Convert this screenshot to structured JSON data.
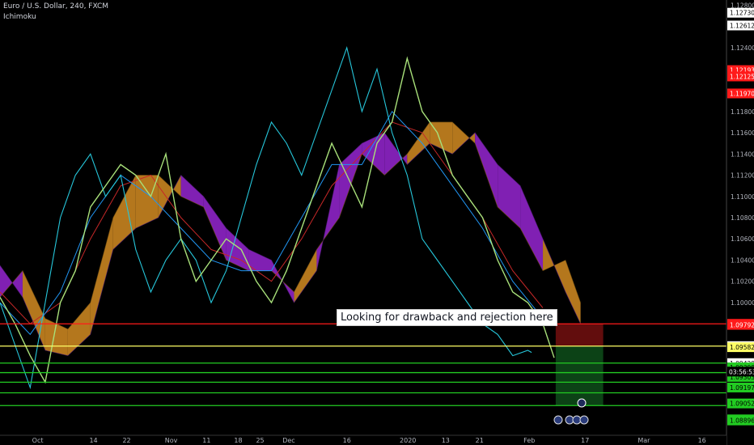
{
  "header": {
    "title": "Euro / U.S. Dollar, 240, FXCM",
    "indicator": "Ichimoku"
  },
  "annotation": "Looking for drawback and rejection here",
  "countdown": "03:56:53",
  "colors": {
    "background": "#000000",
    "price": "#a8e07a",
    "tenkan": "#2196f3",
    "kijun": "#c62828",
    "chikou": "#26c6da",
    "cloud_bull": "#c88420",
    "cloud_bear": "#8e24c7",
    "resistance": "#ff1a1a",
    "pivot": "#ffff66",
    "support": "#22cc22"
  },
  "chart_data": {
    "type": "line",
    "ylim": [
      1.0875,
      1.1285
    ],
    "xlim": [
      0,
      100
    ],
    "x_ticks": [
      {
        "label": "Oct",
        "pos": 5
      },
      {
        "label": "14",
        "pos": 12.4
      },
      {
        "label": "22",
        "pos": 16.8
      },
      {
        "label": "Nov",
        "pos": 22.7
      },
      {
        "label": "11",
        "pos": 27.4
      },
      {
        "label": "18",
        "pos": 31.6
      },
      {
        "label": "25",
        "pos": 34.5
      },
      {
        "label": "Dec",
        "pos": 38.3
      },
      {
        "label": "16",
        "pos": 46
      },
      {
        "label": "2020",
        "pos": 54.1
      },
      {
        "label": "13",
        "pos": 59.1
      },
      {
        "label": "21",
        "pos": 63.6
      },
      {
        "label": "Feb",
        "pos": 70.2
      },
      {
        "label": "17",
        "pos": 77.6
      },
      {
        "label": "Mar",
        "pos": 85.4
      },
      {
        "label": "16",
        "pos": 93.1
      }
    ],
    "y_ticks": [
      1.128,
      1.1273,
      1.1261,
      1.124,
      1.1219,
      1.1213,
      1.1197,
      1.118,
      1.116,
      1.114,
      1.112,
      1.11,
      1.108,
      1.106,
      1.104,
      1.102,
      1.1,
      1.098,
      1.0979,
      1.0959,
      1.0958,
      1.0943,
      1.0939,
      1.093,
      1.092,
      1.0905,
      1.089,
      1.0889
    ],
    "price_labels": [
      {
        "value": 1.1273,
        "label": "1.12730",
        "bg": "#ffffff",
        "fg": "#000000"
      },
      {
        "value": 1.1261,
        "label": "1.12612",
        "bg": "#ffffff",
        "fg": "#000000"
      },
      {
        "value": 1.1219,
        "label": "1.12193",
        "bg": "#ff1a1a",
        "fg": "#ffffff"
      },
      {
        "value": 1.1213,
        "label": "1.12125",
        "bg": "#ff1a1a",
        "fg": "#ffffff"
      },
      {
        "value": 1.1197,
        "label": "1.11970",
        "bg": "#ff1a1a",
        "fg": "#ffffff"
      },
      {
        "value": 1.098,
        "label": "1.09800",
        "bg": "#ff1a1a",
        "fg": "#ffffff"
      },
      {
        "value": 1.0979,
        "label": "1.09792",
        "bg": "#ff1a1a",
        "fg": "#ffffff"
      },
      {
        "value": 1.0959,
        "label": "1.09590",
        "bg": "#ffffff",
        "fg": "#000000"
      },
      {
        "value": 1.0958,
        "label": "1.09582",
        "bg": "#ffff66",
        "fg": "#000000"
      },
      {
        "value": 1.0943,
        "label": "1.09429",
        "bg": "#ffffff",
        "fg": "#000000"
      },
      {
        "value": 1.0939,
        "label": "1.09398",
        "bg": "#22cc22",
        "fg": "#000000"
      },
      {
        "value": 1.093,
        "label": "1.09303",
        "bg": "#22cc22",
        "fg": "#000000"
      },
      {
        "value": 1.092,
        "label": "1.09197",
        "bg": "#22cc22",
        "fg": "#000000"
      },
      {
        "value": 1.0905,
        "label": "1.09052",
        "bg": "#22cc22",
        "fg": "#000000"
      },
      {
        "value": 1.089,
        "label": "1.08902",
        "bg": "#22cc22",
        "fg": "#000000"
      },
      {
        "value": 1.0889,
        "label": "1.08896",
        "bg": "#22cc22",
        "fg": "#000000"
      }
    ],
    "horizontal_lines": [
      {
        "value": 1.098,
        "color": "#ff1a1a"
      },
      {
        "value": 1.0959,
        "color": "#ffff66"
      },
      {
        "value": 1.0943,
        "color": "#22cc22"
      },
      {
        "value": 1.0934,
        "color": "#22cc22"
      },
      {
        "value": 1.0925,
        "color": "#22cc22"
      },
      {
        "value": 1.0915,
        "color": "#22cc22"
      },
      {
        "value": 1.0903,
        "color": "#22cc22"
      }
    ],
    "series": [
      {
        "key": "price",
        "x": [
          0,
          2,
          4,
          6,
          8,
          10,
          12,
          14,
          16,
          18,
          20,
          22,
          24,
          26,
          28,
          30,
          32,
          34,
          36,
          38,
          40,
          42,
          44,
          46,
          48,
          50,
          52,
          54,
          56,
          58,
          60,
          62,
          64,
          66,
          68,
          70,
          72,
          73.5
        ],
        "values": [
          1.1005,
          1.098,
          1.095,
          1.0925,
          1.1,
          1.103,
          1.109,
          1.111,
          1.113,
          1.112,
          1.11,
          1.114,
          1.106,
          1.102,
          1.104,
          1.106,
          1.105,
          1.102,
          1.1,
          1.103,
          1.107,
          1.111,
          1.115,
          1.112,
          1.109,
          1.115,
          1.117,
          1.123,
          1.118,
          1.116,
          1.112,
          1.11,
          1.108,
          1.104,
          1.101,
          1.1,
          1.098,
          1.0948
        ]
      },
      {
        "key": "chikou",
        "x": [
          0,
          2,
          4,
          6,
          8,
          10,
          12,
          14,
          16,
          18,
          20,
          22,
          24,
          26,
          28,
          30,
          32,
          34,
          36,
          38,
          40,
          42,
          44,
          46,
          48,
          50,
          52,
          54,
          56,
          58,
          60,
          62,
          64,
          66,
          68,
          70,
          70.5
        ],
        "values": [
          1.1,
          1.096,
          1.092,
          1.1,
          1.108,
          1.112,
          1.114,
          1.11,
          1.112,
          1.105,
          1.101,
          1.104,
          1.106,
          1.104,
          1.1,
          1.103,
          1.108,
          1.113,
          1.117,
          1.115,
          1.112,
          1.116,
          1.12,
          1.124,
          1.118,
          1.122,
          1.116,
          1.112,
          1.106,
          1.104,
          1.102,
          1.1,
          1.098,
          1.097,
          1.095,
          1.0955,
          1.0953
        ]
      },
      {
        "key": "tenkan",
        "x": [
          0,
          4,
          8,
          12,
          16,
          20,
          24,
          28,
          32,
          36,
          40,
          44,
          48,
          52,
          56,
          60,
          64,
          68,
          72
        ],
        "values": [
          1.1,
          1.097,
          1.101,
          1.108,
          1.112,
          1.11,
          1.107,
          1.104,
          1.103,
          1.103,
          1.108,
          1.113,
          1.113,
          1.118,
          1.115,
          1.111,
          1.107,
          1.102,
          1.0985
        ]
      },
      {
        "key": "kijun",
        "x": [
          0,
          4,
          8,
          12,
          16,
          20,
          24,
          28,
          32,
          36,
          40,
          44,
          48,
          52,
          56,
          60,
          64,
          68,
          72
        ],
        "values": [
          1.101,
          1.098,
          1.1,
          1.106,
          1.111,
          1.112,
          1.108,
          1.105,
          1.104,
          1.102,
          1.106,
          1.111,
          1.114,
          1.117,
          1.116,
          1.112,
          1.108,
          1.103,
          1.0995
        ]
      },
      {
        "key": "span_a",
        "x": [
          0,
          3,
          6,
          9,
          12,
          15,
          18,
          21,
          24,
          27,
          30,
          33,
          36,
          39,
          42,
          45,
          48,
          51,
          54,
          57,
          60,
          63,
          66,
          69,
          72,
          75,
          77
        ],
        "values": [
          1.1005,
          1.103,
          1.0985,
          1.0975,
          1.1,
          1.108,
          1.112,
          1.112,
          1.11,
          1.109,
          1.104,
          1.103,
          1.103,
          1.101,
          1.105,
          1.108,
          1.114,
          1.112,
          1.114,
          1.117,
          1.117,
          1.115,
          1.109,
          1.107,
          1.103,
          1.104,
          1.1
        ]
      },
      {
        "key": "span_b",
        "x": [
          0,
          3,
          6,
          9,
          12,
          15,
          18,
          21,
          24,
          27,
          30,
          33,
          36,
          39,
          42,
          45,
          48,
          51,
          54,
          57,
          60,
          63,
          66,
          69,
          72,
          75,
          77
        ],
        "values": [
          1.1035,
          1.1005,
          1.0955,
          1.095,
          1.097,
          1.105,
          1.107,
          1.108,
          1.112,
          1.11,
          1.107,
          1.105,
          1.104,
          1.1,
          1.103,
          1.113,
          1.115,
          1.116,
          1.113,
          1.115,
          1.114,
          1.116,
          1.113,
          1.111,
          1.106,
          1.101,
          1.098
        ]
      }
    ]
  }
}
